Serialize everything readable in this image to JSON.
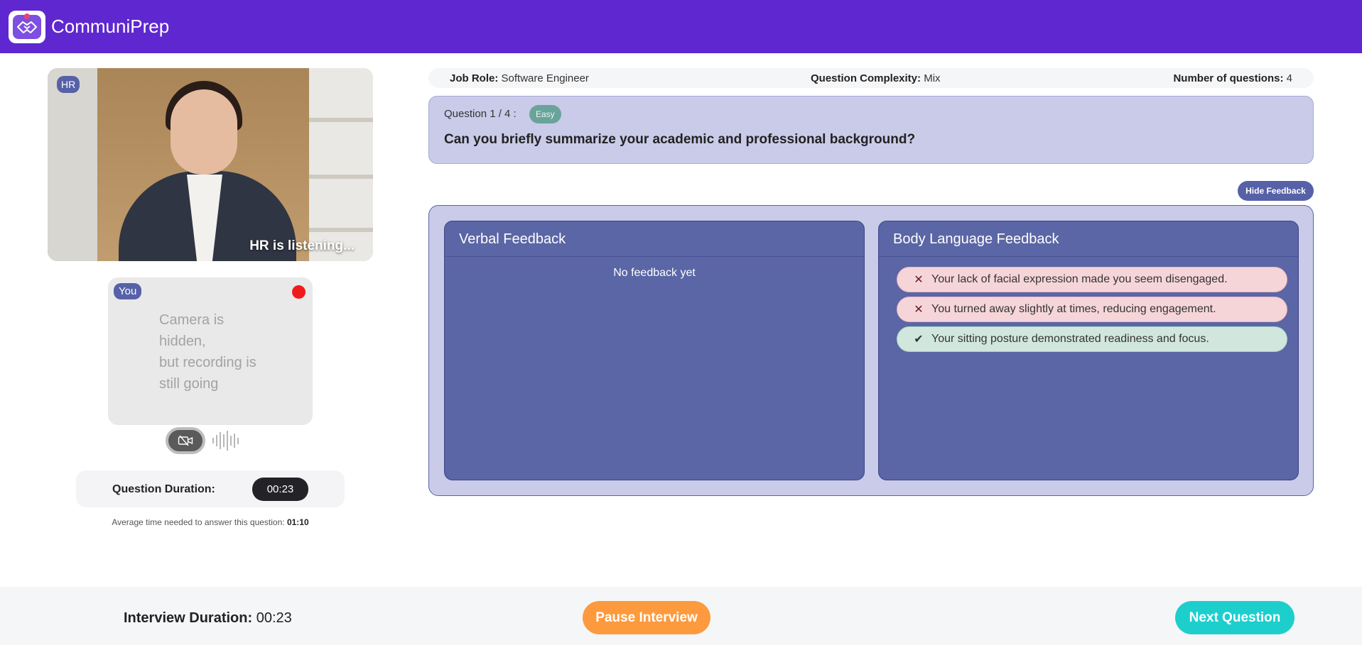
{
  "app": {
    "name": "CommuniPrep"
  },
  "interviewer": {
    "badge": "HR",
    "status": "HR is listening..."
  },
  "candidate": {
    "badge": "You",
    "camera_hidden_lines": [
      "Camera is",
      "hidden,",
      "but recording is",
      "still going"
    ]
  },
  "question_timer": {
    "label": "Question Duration:",
    "value": "00:23",
    "avg_prefix": "Average time needed to answer this question:",
    "avg_value": "01:10"
  },
  "info_bar": {
    "job_role_label": "Job Role:",
    "job_role_value": "Software Engineer",
    "complexity_label": "Question Complexity:",
    "complexity_value": "Mix",
    "count_label": "Number of questions:",
    "count_value": "4"
  },
  "question": {
    "number_text": "Question 1 / 4 :",
    "difficulty": "Easy",
    "text": "Can you briefly summarize your academic and professional background?"
  },
  "feedback": {
    "toggle_label": "Hide Feedback",
    "verbal": {
      "title": "Verbal Feedback",
      "empty_text": "No feedback yet"
    },
    "body": {
      "title": "Body Language Feedback",
      "items": [
        {
          "type": "negative",
          "icon": "cross-icon",
          "text": "Your lack of facial expression made you seem disengaged."
        },
        {
          "type": "negative",
          "icon": "cross-icon",
          "text": "You turned away slightly at times, reducing engagement."
        },
        {
          "type": "positive",
          "icon": "check-icon",
          "text": "Your sitting posture demonstrated readiness and focus."
        }
      ]
    }
  },
  "footer": {
    "interview_duration_label": "Interview Duration:",
    "interview_duration_value": "00:23",
    "pause_label": "Pause Interview",
    "next_label": "Next Question"
  },
  "colors": {
    "header": "#5f27d0",
    "accent_badge": "#5661a7",
    "pause": "#fd9a3e",
    "next": "#1ccfcd",
    "recording": "#f11b1b"
  }
}
